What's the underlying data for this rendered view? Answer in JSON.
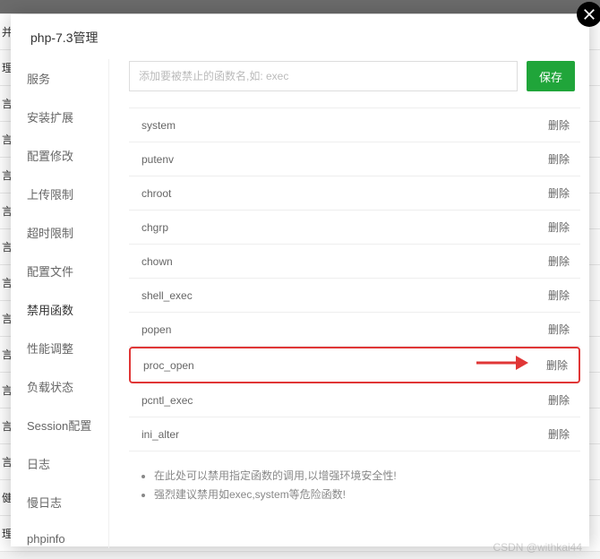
{
  "bg_labels": [
    "",
    "并",
    "理",
    "言",
    "言",
    "言",
    "言",
    "言",
    "言",
    "言",
    "言",
    "言",
    "言",
    "言",
    "健",
    "理"
  ],
  "dialog": {
    "title": "php-7.3管理"
  },
  "sidebar": {
    "items": [
      {
        "label": "服务"
      },
      {
        "label": "安装扩展"
      },
      {
        "label": "配置修改"
      },
      {
        "label": "上传限制"
      },
      {
        "label": "超时限制"
      },
      {
        "label": "配置文件"
      },
      {
        "label": "禁用函数"
      },
      {
        "label": "性能调整"
      },
      {
        "label": "负载状态"
      },
      {
        "label": "Session配置"
      },
      {
        "label": "日志"
      },
      {
        "label": "慢日志"
      },
      {
        "label": "phpinfo"
      }
    ],
    "active_index": 6
  },
  "input": {
    "placeholder": "添加要被禁止的函数名,如: exec",
    "value": ""
  },
  "save_label": "保存",
  "delete_label": "删除",
  "functions": [
    {
      "name": "system"
    },
    {
      "name": "putenv"
    },
    {
      "name": "chroot"
    },
    {
      "name": "chgrp"
    },
    {
      "name": "chown"
    },
    {
      "name": "shell_exec"
    },
    {
      "name": "popen"
    },
    {
      "name": "proc_open",
      "highlight": true
    },
    {
      "name": "pcntl_exec"
    },
    {
      "name": "ini_alter"
    }
  ],
  "tips": [
    "在此处可以禁用指定函数的调用,以增强环境安全性!",
    "强烈建议禁用如exec,system等危险函数!"
  ],
  "watermark": "CSDN @withkai44"
}
